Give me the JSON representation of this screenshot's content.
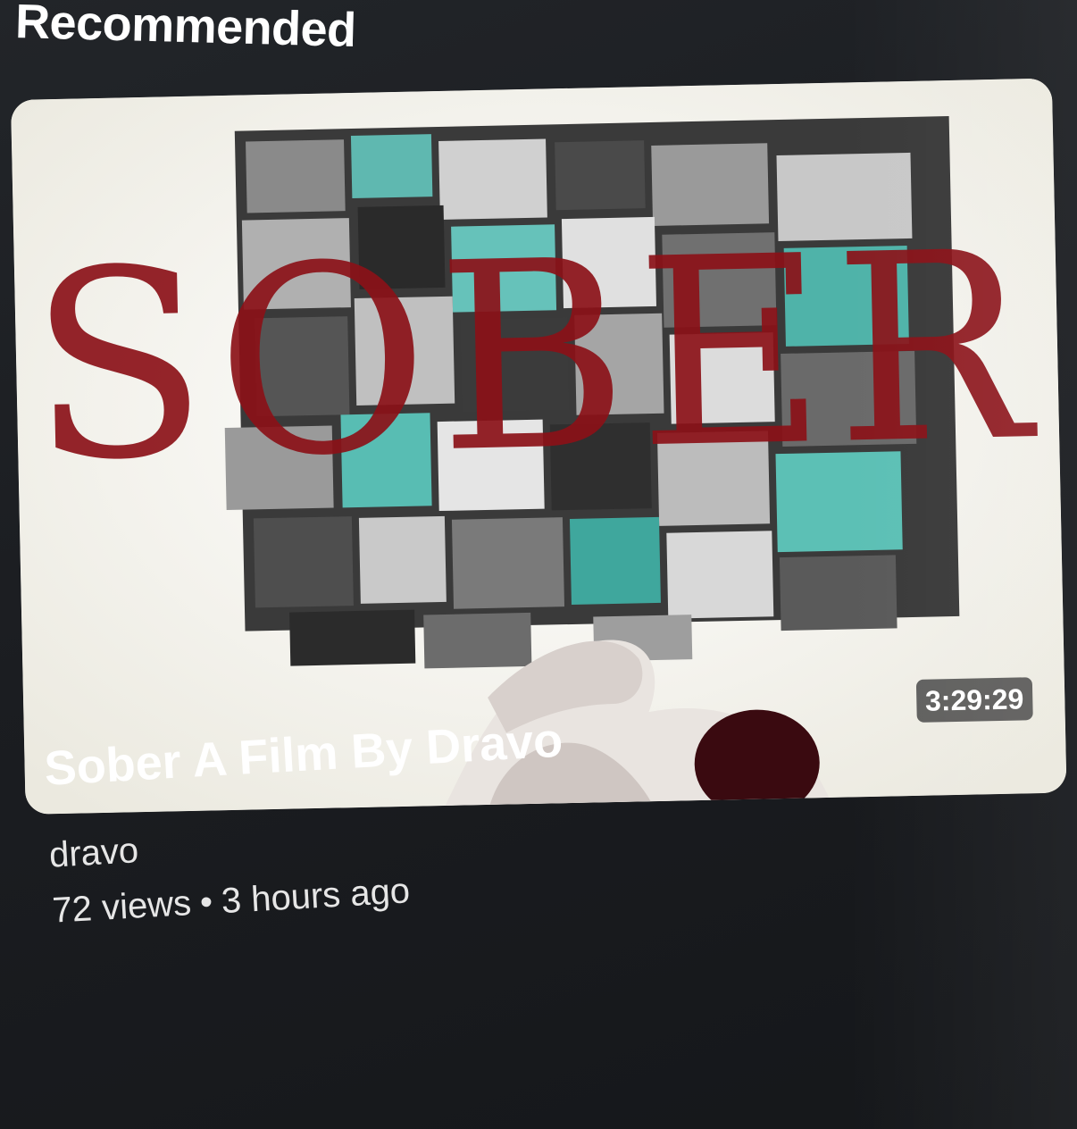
{
  "section": {
    "title": "Recommended"
  },
  "video": {
    "thumbnail_title_text": "SOBER",
    "duration": "3:29:29",
    "title": "Sober A Film By Dravo",
    "channel": "dravo",
    "views": "72 views",
    "separator": "•",
    "age": "3 hours ago"
  },
  "colors": {
    "background": "#1b1d21",
    "text_primary": "#ffffff",
    "text_secondary": "#e6e6e6",
    "duration_badge": "#464646",
    "thumbnail_title": "#8b1118"
  }
}
